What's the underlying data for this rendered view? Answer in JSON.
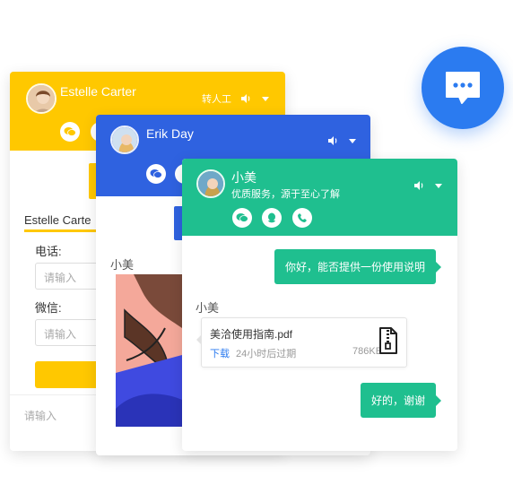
{
  "colors": {
    "yellow": "#ffc800",
    "blue": "#2f62e0",
    "green": "#1fbf8f",
    "fab": "#2b7bf0"
  },
  "fab": {
    "icon": "chat-bubble-icon"
  },
  "window_yellow": {
    "agent_name": "Estelle Carter",
    "transfer_label": "转人工",
    "form_title": "Estelle Carte",
    "phone_label": "电话:",
    "phone_placeholder": "请输入",
    "wechat_label": "微信:",
    "wechat_placeholder": "请输入",
    "bottom_placeholder": "请输入"
  },
  "window_blue": {
    "agent_name": "Erik Day",
    "sender_label": "小美"
  },
  "window_green": {
    "agent_name": "小美",
    "subtitle": "优质服务，源于至心了解",
    "messages": {
      "user_1": "你好，能否提供一份使用说明",
      "sender_label": "小美",
      "file": {
        "name": "美洽使用指南.pdf",
        "download": "下载",
        "expires": "24小时后过期",
        "size": "786KB"
      },
      "user_2": "好的，谢谢"
    }
  }
}
